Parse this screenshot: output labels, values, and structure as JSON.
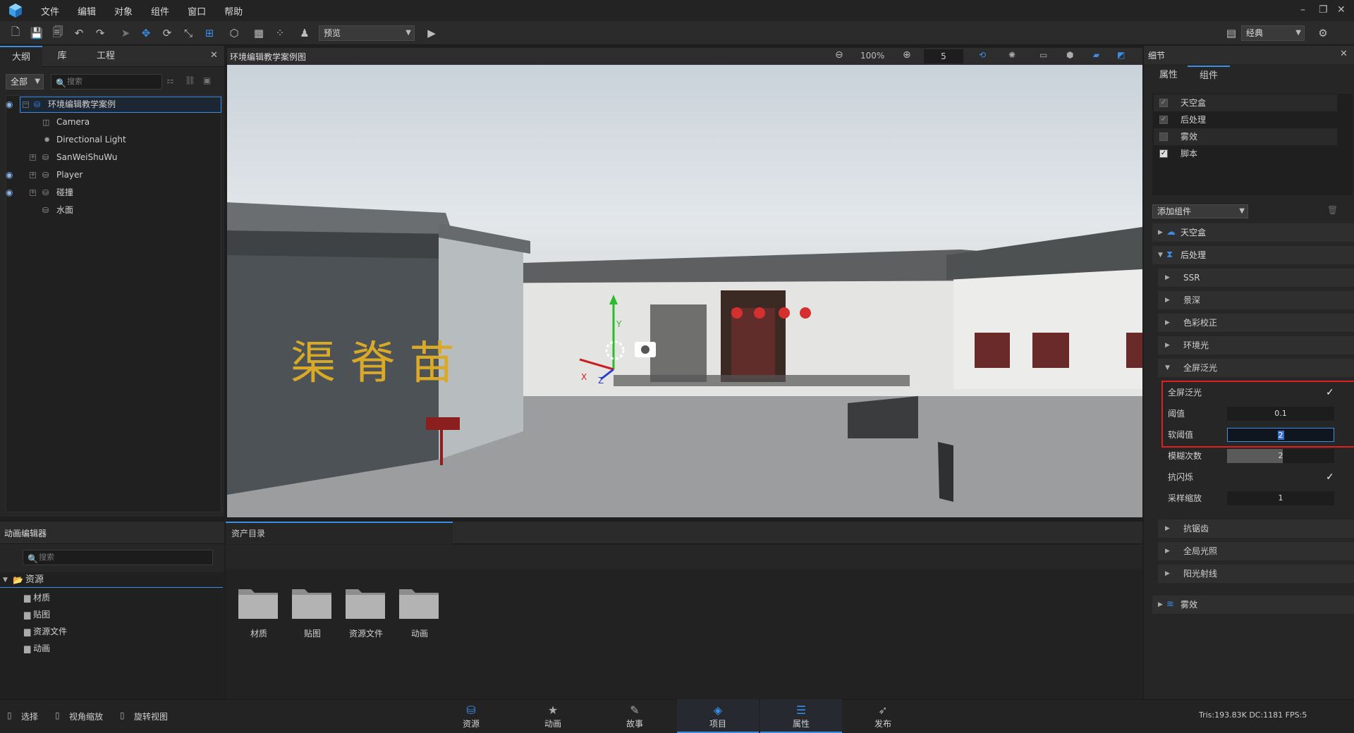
{
  "menubar": {
    "items": [
      "文件",
      "编辑",
      "对象",
      "组件",
      "窗口",
      "帮助"
    ]
  },
  "toolbar": {
    "mode_select": "预览",
    "layout_select": "经典"
  },
  "outline": {
    "tabs": [
      "大纲",
      "库",
      "工程"
    ],
    "filter": "全部",
    "search_placeholder": "搜索",
    "tree": [
      {
        "label": "环境编辑教学案例",
        "selected": true
      },
      {
        "label": "Camera"
      },
      {
        "label": "Directional Light"
      },
      {
        "label": "SanWeiShuWu"
      },
      {
        "label": "Player"
      },
      {
        "label": "碰撞"
      },
      {
        "label": "水面"
      }
    ]
  },
  "viewport": {
    "title": "环境编辑教学案例图",
    "zoom": "100%",
    "speed": "5",
    "scene_sign": "渠 脊 苗",
    "gizmo": {
      "x": "X",
      "y": "Y",
      "z": "Z"
    }
  },
  "details": {
    "title": "细节",
    "tabs": [
      "属性",
      "组件"
    ],
    "components": [
      {
        "label": "天空盒",
        "checked": true,
        "dim": true
      },
      {
        "label": "后处理",
        "checked": true,
        "dim": true
      },
      {
        "label": "雾效",
        "checked": false
      },
      {
        "label": "脚本",
        "checked": true
      }
    ],
    "add_component": "添加组件",
    "sections": {
      "skybox": "天空盒",
      "postprocess": "后处理",
      "fog": "雾效"
    },
    "post_items": [
      "SSR",
      "景深",
      "色彩校正",
      "环境光",
      "全屏泛光"
    ],
    "bloom_props": {
      "enable_label": "全屏泛光",
      "threshold_label": "阈值",
      "threshold_value": "0.1",
      "soft_label": "软阈值",
      "soft_value": "2",
      "blur_label": "模糊次数",
      "blur_value": "2",
      "anti_flicker_label": "抗闪烁",
      "scale_label": "采样缩放",
      "scale_value": "1"
    },
    "post_items_after": [
      "抗锯齿",
      "全局光照",
      "阳光射线"
    ]
  },
  "anim_editor": {
    "title": "动画编辑器",
    "search_placeholder": "搜索"
  },
  "assets": {
    "tab": "资产目录",
    "tree_root": "资源",
    "tree_children": [
      "材质",
      "贴图",
      "资源文件",
      "动画"
    ],
    "folders": [
      "材质",
      "贴图",
      "资源文件",
      "动画"
    ]
  },
  "statusbar": {
    "tools": [
      "选择",
      "视角缩放",
      "旋转视图"
    ],
    "nav": [
      "资源",
      "动画",
      "故事",
      "项目",
      "属性",
      "发布"
    ],
    "active_nav": [
      "项目",
      "属性"
    ],
    "stats": "Tris:193.83K   DC:1181     FPS:5"
  },
  "colors": {
    "accent": "#3a8ee6",
    "highlight_border": "#e02020"
  }
}
